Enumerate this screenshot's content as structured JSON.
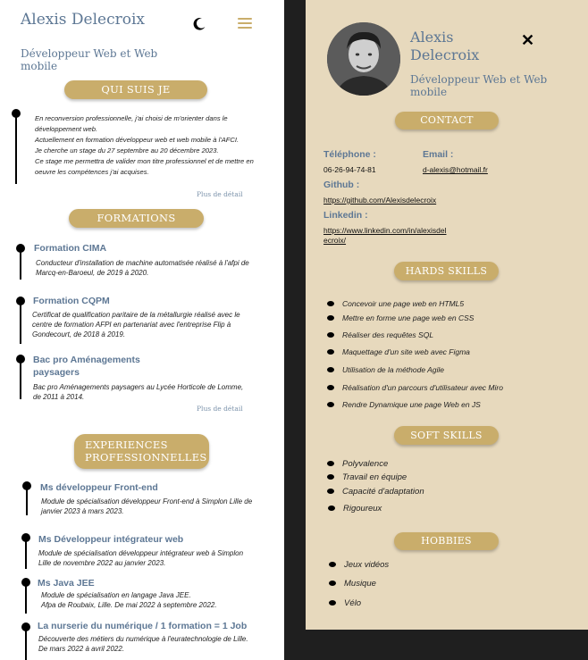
{
  "left": {
    "name": "Alexis Delecroix",
    "job": "Développeur Web et Web mobile",
    "about": {
      "title": "QUI SUIS JE",
      "text": "En reconversion professionnelle, j'ai choisi de m'orienter dans le développement web.\nActuellement en formation développeur web et web mobile à l'AFCI.\nJe cherche un stage du 27 septembre au 20 décembre 2023.\nCe stage me permettra de valider mon titre professionnel et de mettre en oeuvre les compétences j'ai acquises.",
      "more": "Plus de détail"
    },
    "formations": {
      "title": "FORMATIONS",
      "items": [
        {
          "title": "Formation CIMA",
          "text": "Conducteur d'installation de machine automatisée réalisé à l'afpi de Marcq-en-Baroeul, de 2019 à 2020."
        },
        {
          "title": "Formation CQPM",
          "text": "Certificat de qualification paritaire de la métallurgie réalisé avec le centre de formation AFPI en partenariat avec l'entreprise Flip à Gondecourt, de 2018 à 2019."
        },
        {
          "title": "Bac pro Aménagements paysagers",
          "text": "Bac pro Aménagements paysagers au Lycée Horticole de Lomme, de 2011 à 2014."
        }
      ],
      "more": "Plus de détail"
    },
    "experiences": {
      "title": "EXPERIENCES PROFESSIONNELLES",
      "items": [
        {
          "title": "Ms développeur Front-end",
          "text": "Module de spécialisation développeur Front-end à Simplon Lille de janvier 2023 à mars 2023."
        },
        {
          "title": "Ms Développeur intégrateur web",
          "text": "Module de spécialisation développeur intégrateur web à Simplon Lille de novembre 2022 au janvier 2023."
        },
        {
          "title": "Ms Java JEE",
          "text": "Module de spécialisation en langage Java JEE.\nAfpa de Roubaix, Lille. De mai 2022 à septembre 2022."
        },
        {
          "title": "La nurserie du numérique / 1 formation = 1 Job",
          "text": "Découverte des métiers du numérique à l'euratechnologie de Lille. De mars 2022 à avril 2022."
        }
      ]
    }
  },
  "right": {
    "name": "Alexis Delecroix",
    "job": "Développeur Web et Web mobile",
    "close": "✕",
    "contact": {
      "title": "CONTACT",
      "phone_label": "Téléphone :",
      "phone": "06-26-94-74-81",
      "email_label": "Email :",
      "email": "d-alexis@hotmail.fr",
      "github_label": "Github :",
      "github": "https://github.com/Alexisdelecroix",
      "linkedin_label": "Linkedin :",
      "linkedin": "https://www.linkedin.com/in/alexisdelecroix/"
    },
    "hard_skills": {
      "title": "HARDS SKILLS",
      "items": [
        "Concevoir une page web en HTML5",
        "Mettre en forme une page web en CSS",
        "Réaliser des requêtes SQL",
        "Maquettage d'un site web avec Figma",
        "Utilisation de la méthode Agile",
        "Réalisation d'un parcours d'utilisateur avec Miro",
        "Rendre Dynamique une page Web en JS"
      ]
    },
    "soft_skills": {
      "title": "SOFT SKILLS",
      "items": [
        "Polyvalence",
        "Travail en équipe",
        "Capacité d'adaptation",
        "Rigoureux"
      ]
    },
    "hobbies": {
      "title": "HOBBIES",
      "items": [
        "Jeux vidéos",
        "Musique",
        "Vélo"
      ]
    }
  },
  "colors": {
    "accent": "#c9ad6b",
    "heading": "#5d7794",
    "panel": "#e7d9bd",
    "backdrop": "#1f1f1f"
  },
  "icons": {
    "theme_toggle": "moon-icon",
    "menu": "hamburger-icon",
    "close": "close-icon"
  }
}
